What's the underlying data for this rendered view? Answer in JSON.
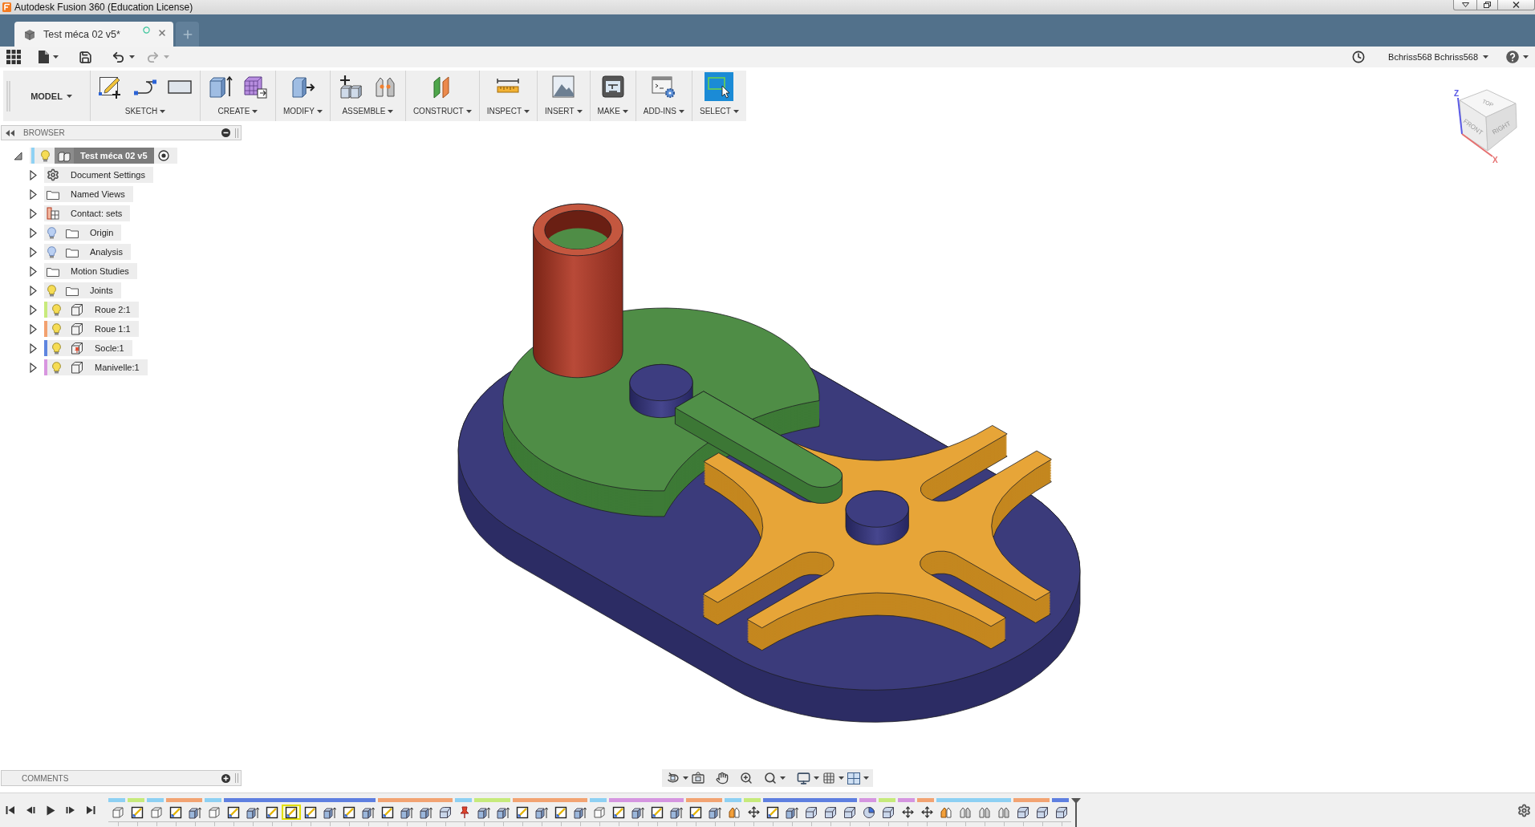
{
  "window": {
    "title": "Autodesk Fusion 360 (Education License)"
  },
  "tabs": [
    {
      "label": "Test méca 02 v5*",
      "selected": true
    }
  ],
  "quick_access": {
    "undo": {
      "disabled": false
    },
    "redo": {
      "disabled": true
    },
    "user": "Bchriss568 Bchriss568"
  },
  "toolbar": {
    "workspace": "MODEL",
    "groups": [
      {
        "label": "SKETCH",
        "tools": [
          {
            "kind": "sketch",
            "selected": false
          },
          {
            "kind": "line",
            "selected": false
          },
          {
            "kind": "rectangle",
            "selected": false
          }
        ]
      },
      {
        "label": "CREATE",
        "tools": [
          {
            "kind": "extrude",
            "selected": false
          },
          {
            "kind": "form",
            "selected": false
          }
        ]
      },
      {
        "label": "MODIFY",
        "tools": [
          {
            "kind": "presspull",
            "selected": false
          }
        ]
      },
      {
        "label": "ASSEMBLE",
        "tools": [
          {
            "kind": "component",
            "selected": false
          },
          {
            "kind": "joint",
            "selected": false
          }
        ]
      },
      {
        "label": "CONSTRUCT",
        "tools": [
          {
            "kind": "plane",
            "selected": false
          }
        ]
      },
      {
        "label": "INSPECT",
        "tools": [
          {
            "kind": "measure",
            "selected": false
          }
        ]
      },
      {
        "label": "INSERT",
        "tools": [
          {
            "kind": "image",
            "selected": false
          }
        ]
      },
      {
        "label": "MAKE",
        "tools": [
          {
            "kind": "print",
            "selected": false
          }
        ]
      },
      {
        "label": "ADD-INS",
        "tools": [
          {
            "kind": "scripts",
            "selected": false
          }
        ]
      },
      {
        "label": "SELECT",
        "tools": [
          {
            "kind": "select",
            "selected": true
          }
        ]
      }
    ]
  },
  "browser": {
    "title": "BROWSER",
    "root": {
      "kind": "assembly",
      "name": "Test méca 02 v5",
      "expanded": true,
      "visible": true,
      "active": true,
      "color": "#8fd2f4",
      "children": [
        {
          "kind": "settings",
          "name": "Document Settings",
          "expanded": false
        },
        {
          "kind": "folder",
          "name": "Named Views",
          "expanded": false
        },
        {
          "kind": "contacts",
          "name": "Contact: sets",
          "expanded": false
        },
        {
          "kind": "folder",
          "name": "Origin",
          "expanded": false,
          "visible": false
        },
        {
          "kind": "folder",
          "name": "Analysis",
          "expanded": false,
          "visible": false
        },
        {
          "kind": "folder",
          "name": "Motion Studies",
          "expanded": false
        },
        {
          "kind": "folder",
          "name": "Joints",
          "expanded": false,
          "visible": true
        },
        {
          "kind": "component",
          "name": "Roue 2:1",
          "expanded": false,
          "visible": true,
          "color": "#c8ea7c"
        },
        {
          "kind": "component",
          "name": "Roue 1:1",
          "expanded": false,
          "visible": true,
          "color": "#f2a16f"
        },
        {
          "kind": "grounded",
          "name": "Socle:1",
          "expanded": false,
          "visible": true,
          "color": "#5f86e0"
        },
        {
          "kind": "component",
          "name": "Manivelle:1",
          "expanded": false,
          "visible": true,
          "color": "#d896e0"
        }
      ]
    }
  },
  "view_cube": {
    "top": "TOP",
    "front": "FRONT",
    "right": "RIGHT",
    "axis_z": "Z",
    "axis_x": "X"
  },
  "comments": {
    "title": "COMMENTS"
  },
  "timeline": {
    "groups": [
      {
        "color": "#8dd0f3",
        "features": [
          {
            "kind": "component",
            "selected": false
          }
        ]
      },
      {
        "color": "#c6ea7b",
        "features": [
          {
            "kind": "sketch",
            "selected": false
          }
        ]
      },
      {
        "color": "#8dd0f3",
        "features": [
          {
            "kind": "component",
            "selected": false
          }
        ]
      },
      {
        "color": "#f2a372",
        "features": [
          {
            "kind": "sketch",
            "selected": false
          },
          {
            "kind": "extrude",
            "selected": false
          }
        ]
      },
      {
        "color": "#8dd0f3",
        "features": [
          {
            "kind": "component",
            "selected": false
          }
        ]
      },
      {
        "color": "#5e7fe0",
        "features": [
          {
            "kind": "sketch",
            "selected": false
          },
          {
            "kind": "extrude",
            "selected": false
          },
          {
            "kind": "sketch",
            "selected": false
          },
          {
            "kind": "sketch",
            "selected": true
          },
          {
            "kind": "sketch",
            "selected": false
          },
          {
            "kind": "extrude",
            "selected": false
          },
          {
            "kind": "sketch",
            "selected": false
          },
          {
            "kind": "extrude",
            "selected": false
          }
        ]
      },
      {
        "color": "#f2a372",
        "features": [
          {
            "kind": "sketch",
            "selected": false
          },
          {
            "kind": "extrude",
            "selected": false
          },
          {
            "kind": "extrude",
            "selected": false
          },
          {
            "kind": "fillet",
            "selected": false
          }
        ]
      },
      {
        "color": "#8dd0f3",
        "features": [
          {
            "kind": "ground",
            "selected": false
          }
        ]
      },
      {
        "color": "#c6ea7b",
        "features": [
          {
            "kind": "extrude",
            "selected": false
          },
          {
            "kind": "extrude",
            "selected": false
          }
        ]
      },
      {
        "color": "#f2a372",
        "features": [
          {
            "kind": "sketch",
            "selected": false
          },
          {
            "kind": "extrude",
            "selected": false
          },
          {
            "kind": "sketch",
            "selected": false
          },
          {
            "kind": "extrude",
            "selected": false
          }
        ]
      },
      {
        "color": "#8dd0f3",
        "features": [
          {
            "kind": "component",
            "selected": false
          }
        ]
      },
      {
        "color": "#d595e0",
        "features": [
          {
            "kind": "sketch",
            "selected": false
          },
          {
            "kind": "extrude",
            "selected": false
          },
          {
            "kind": "sketch",
            "selected": false
          },
          {
            "kind": "extrude",
            "selected": false
          }
        ]
      },
      {
        "color": "#f2a372",
        "features": [
          {
            "kind": "sketch",
            "selected": false
          },
          {
            "kind": "extrude",
            "selected": false
          }
        ]
      },
      {
        "color": "#8dd0f3",
        "features": [
          {
            "kind": "joint",
            "selected": false
          }
        ]
      },
      {
        "color": "#c6ea7b",
        "features": [
          {
            "kind": "move",
            "selected": false
          }
        ]
      },
      {
        "color": "#5e7fe0",
        "features": [
          {
            "kind": "sketch",
            "selected": false
          },
          {
            "kind": "extrude",
            "selected": false
          },
          {
            "kind": "fillet",
            "selected": false
          },
          {
            "kind": "fillet",
            "selected": false
          },
          {
            "kind": "fillet",
            "selected": false
          }
        ]
      },
      {
        "color": "#d595e0",
        "features": [
          {
            "kind": "revolve",
            "selected": false
          }
        ]
      },
      {
        "color": "#c6ea7b",
        "features": [
          {
            "kind": "fillet",
            "selected": false
          }
        ]
      },
      {
        "color": "#d595e0",
        "features": [
          {
            "kind": "move",
            "selected": false
          }
        ]
      },
      {
        "color": "#f2a372",
        "features": [
          {
            "kind": "move",
            "selected": false
          }
        ]
      },
      {
        "color": "#8dd0f3",
        "features": [
          {
            "kind": "joint",
            "selected": false
          },
          {
            "kind": "asbuilt",
            "selected": false
          },
          {
            "kind": "asbuilt",
            "selected": false
          },
          {
            "kind": "asbuilt",
            "selected": false
          }
        ]
      },
      {
        "color": "#f2a372",
        "features": [
          {
            "kind": "fillet",
            "selected": false
          },
          {
            "kind": "fillet",
            "selected": false
          }
        ]
      },
      {
        "color": "#5e7fe0",
        "features": [
          {
            "kind": "fillet",
            "selected": false
          }
        ]
      }
    ]
  }
}
